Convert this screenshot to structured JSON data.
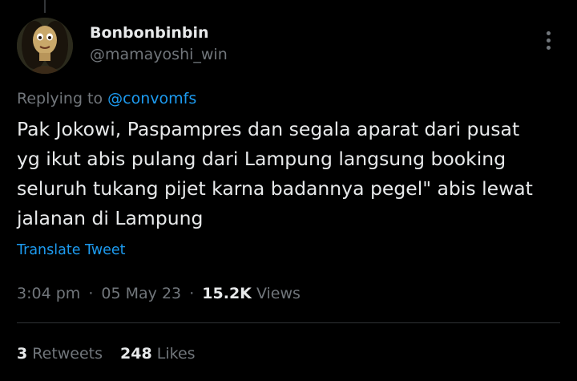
{
  "author": {
    "display_name": "Bonbonbinbin",
    "handle": "@mamayoshi_win"
  },
  "reply": {
    "prefix": "Replying to",
    "mention": "@convomfs"
  },
  "tweet": {
    "lines": [
      "Pak Jokowi, Paspampres dan segala aparat dari pusat",
      "yg ikut abis pulang dari Lampung langsung booking",
      "seluruh tukang pijet karna badannya pegel\" abis lewat",
      "jalanan di Lampung"
    ],
    "translate_label": "Translate Tweet"
  },
  "meta": {
    "time": "3:04 pm",
    "separator": "·",
    "date": "05 May 23",
    "views_count": "15.2K",
    "views_label": "Views"
  },
  "stats": {
    "retweets_count": "3",
    "retweets_label": "Retweets",
    "likes_count": "248",
    "likes_label": "Likes"
  },
  "icons": {
    "more": "more-options-icon",
    "avatar": "profile-avatar"
  },
  "colors": {
    "background": "#000000",
    "text_primary": "#e7e9ea",
    "text_secondary": "#71767b",
    "accent": "#1d9bf0",
    "divider": "#2f3336"
  }
}
